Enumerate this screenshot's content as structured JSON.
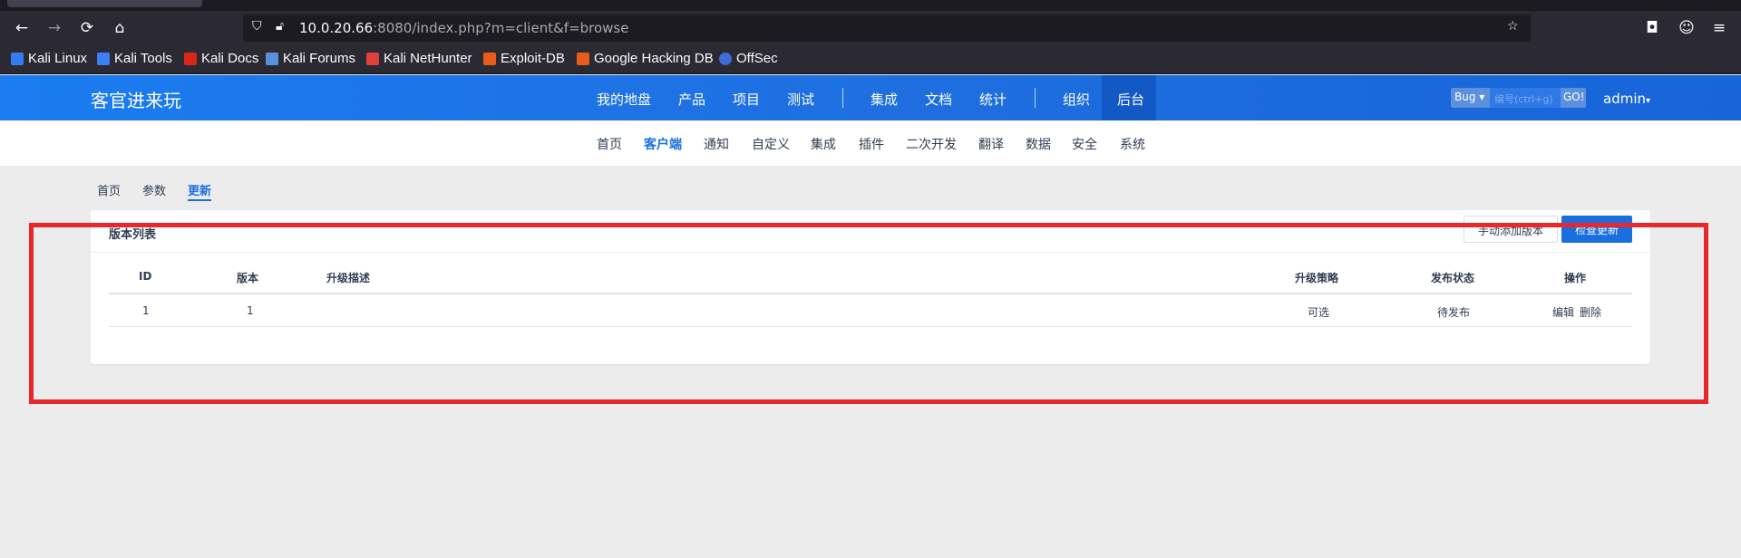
{
  "browser": {
    "url_host": "10.0.20.66",
    "url_rest": ":8080/index.php?m=client&f=browse",
    "bookmarks": [
      "Kali Linux",
      "Kali Tools",
      "Kali Docs",
      "Kali Forums",
      "Kali NetHunter",
      "Exploit-DB",
      "Google Hacking DB",
      "OffSec"
    ]
  },
  "header": {
    "brand": "客官进来玩",
    "nav": [
      "我的地盘",
      "产品",
      "项目",
      "测试",
      "集成",
      "文档",
      "统计",
      "组织",
      "后台"
    ],
    "active_nav": "后台",
    "search": {
      "type": "Bug",
      "placeholder": "编号(ctrl+g)",
      "go": "GO!"
    },
    "user": "admin"
  },
  "subnav": {
    "items": [
      "首页",
      "客户端",
      "通知",
      "自定义",
      "集成",
      "插件",
      "二次开发",
      "翻译",
      "数据",
      "安全",
      "系统"
    ],
    "active": "客户端"
  },
  "page_tabs": {
    "items": [
      "首页",
      "参数",
      "更新"
    ],
    "active": "更新"
  },
  "panel": {
    "title": "版本列表",
    "manual_add": "手动添加版本",
    "check_update": "检查更新",
    "columns": [
      "ID",
      "版本",
      "升级描述",
      "升级策略",
      "发布状态",
      "操作"
    ],
    "rows": [
      {
        "id": "1",
        "version": "1",
        "desc": "",
        "strategy": "可选",
        "status": "待发布",
        "edit": "编辑",
        "delete": "删除"
      }
    ]
  },
  "colors": {
    "accent": "#1a6fe0",
    "highlight": "#e8282b"
  }
}
